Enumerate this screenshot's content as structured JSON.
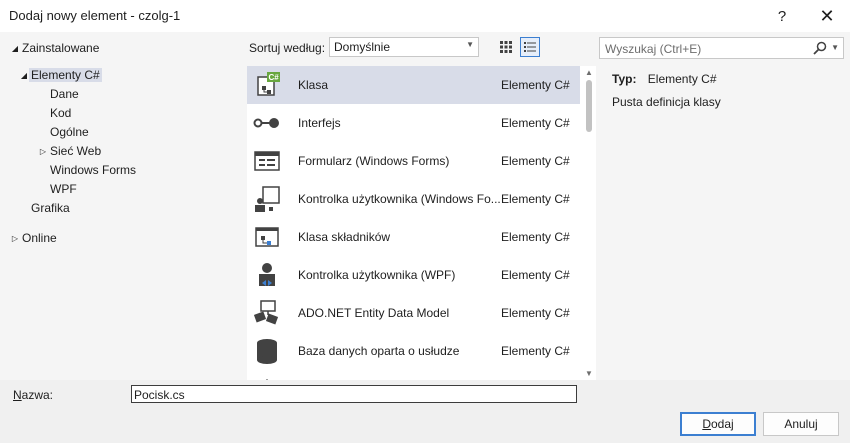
{
  "window": {
    "title": "Dodaj nowy element - czolg-1",
    "help_glyph": "?",
    "close_glyph": "✕"
  },
  "tree": {
    "installed": "Zainstalowane",
    "csharp": "Elementy C#",
    "dane": "Dane",
    "kod": "Kod",
    "ogolne": "Ogólne",
    "siec_web": "Sieć Web",
    "windows_forms": "Windows Forms",
    "wpf": "WPF",
    "grafika": "Grafika",
    "online": "Online"
  },
  "sort": {
    "label": "Sortuj według:",
    "value": "Domyślnie"
  },
  "search": {
    "placeholder": "Wyszukaj (Ctrl+E)"
  },
  "templates": [
    {
      "name": "Klasa",
      "category": "Elementy C#",
      "icon": "class-icon"
    },
    {
      "name": "Interfejs",
      "category": "Elementy C#",
      "icon": "interface-icon"
    },
    {
      "name": "Formularz (Windows Forms)",
      "category": "Elementy C#",
      "icon": "windows-form-icon"
    },
    {
      "name": "Kontrolka użytkownika (Windows Fo...",
      "category": "Elementy C#",
      "icon": "user-control-icon"
    },
    {
      "name": "Klasa składników",
      "category": "Elementy C#",
      "icon": "component-class-icon"
    },
    {
      "name": "Kontrolka użytkownika (WPF)",
      "category": "Elementy C#",
      "icon": "wpf-user-control-icon"
    },
    {
      "name": "ADO.NET Entity Data Model",
      "category": "Elementy C#",
      "icon": "entity-data-model-icon"
    },
    {
      "name": "Baza danych oparta o usłudze",
      "category": "Elementy C#",
      "icon": "database-icon"
    }
  ],
  "details": {
    "type_label": "Typ:",
    "type_value": "Elementy C#",
    "description": "Pusta definicja klasy"
  },
  "bottom": {
    "name_label": "Nazwa:",
    "name_value": "Pocisk.cs",
    "add_label": "Dodaj",
    "cancel_label": "Anuluj"
  },
  "colors": {
    "selection": "#d8dce8",
    "accent": "#3c7fd1",
    "csharp_badge": "#68a73f"
  }
}
